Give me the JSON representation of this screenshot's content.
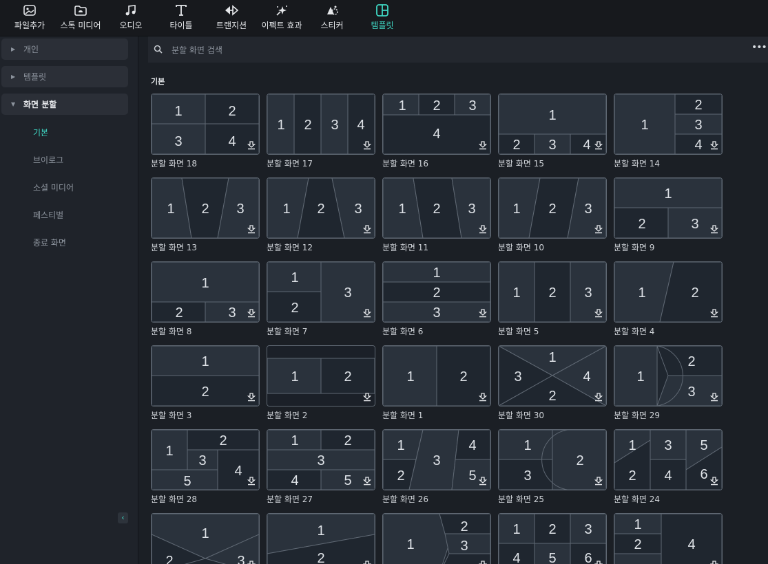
{
  "toolbar": {
    "items": [
      {
        "label": "파일추가",
        "icon": "media-import-icon"
      },
      {
        "label": "스톡 미디어",
        "icon": "stock-media-icon"
      },
      {
        "label": "오디오",
        "icon": "music-note-icon"
      },
      {
        "label": "타이틀",
        "icon": "title-text-icon"
      },
      {
        "label": "트랜지션",
        "icon": "transition-icon"
      },
      {
        "label": "이펙트 효과",
        "icon": "effects-sparkle-icon"
      },
      {
        "label": "스티커",
        "icon": "sticker-icon"
      },
      {
        "label": "템플릿",
        "icon": "template-layout-icon"
      }
    ],
    "active_index": 7,
    "accent_color": "#3fd7c4"
  },
  "sidebar": {
    "folders": [
      {
        "label": "개인",
        "expanded": false
      },
      {
        "label": "템플릿",
        "expanded": false
      },
      {
        "label": "화면 분할",
        "expanded": true
      }
    ],
    "sub_items": [
      "기본",
      "브이로그",
      "소셜 미디어",
      "페스티벌",
      "종료 화면"
    ],
    "active_sub": "기본",
    "collapse_glyph": "‹"
  },
  "search": {
    "placeholder": "분할 화면 검색",
    "more_glyph": "•••"
  },
  "section": {
    "title": "기본"
  },
  "templates": [
    {
      "label": "분할 화면 18",
      "layout": "s18"
    },
    {
      "label": "분할 화면 17",
      "layout": "s17"
    },
    {
      "label": "분할 화면 16",
      "layout": "s16"
    },
    {
      "label": "분할 화면 15",
      "layout": "s15"
    },
    {
      "label": "분할 화면 14",
      "layout": "s14"
    },
    {
      "label": "분할 화면 13",
      "layout": "s13"
    },
    {
      "label": "분할 화면 12",
      "layout": "s12"
    },
    {
      "label": "분할 화면 11",
      "layout": "s11"
    },
    {
      "label": "분할 화면 10",
      "layout": "s10"
    },
    {
      "label": "분할 화면 9",
      "layout": "s9"
    },
    {
      "label": "분할 화면 8",
      "layout": "s8"
    },
    {
      "label": "분할 화면 7",
      "layout": "s7"
    },
    {
      "label": "분할 화면 6",
      "layout": "s6"
    },
    {
      "label": "분할 화면 5",
      "layout": "s5"
    },
    {
      "label": "분할 화면 4",
      "layout": "s4"
    },
    {
      "label": "분할 화면 3",
      "layout": "s3"
    },
    {
      "label": "분할 화면 2",
      "layout": "s2"
    },
    {
      "label": "분할 화면 1",
      "layout": "s1"
    },
    {
      "label": "분할 화면 30",
      "layout": "s30"
    },
    {
      "label": "분할 화면 29",
      "layout": "s29"
    },
    {
      "label": "분할 화면 28",
      "layout": "s28"
    },
    {
      "label": "분할 화면 27",
      "layout": "s27"
    },
    {
      "label": "분할 화면 26",
      "layout": "s26"
    },
    {
      "label": "분할 화면 25",
      "layout": "s25"
    },
    {
      "label": "분할 화면 24",
      "layout": "s24"
    },
    {
      "label": "",
      "layout": "r6a"
    },
    {
      "label": "",
      "layout": "r6b"
    },
    {
      "label": "",
      "layout": "r6c"
    },
    {
      "label": "",
      "layout": "r6d"
    },
    {
      "label": "",
      "layout": "r6e"
    }
  ]
}
